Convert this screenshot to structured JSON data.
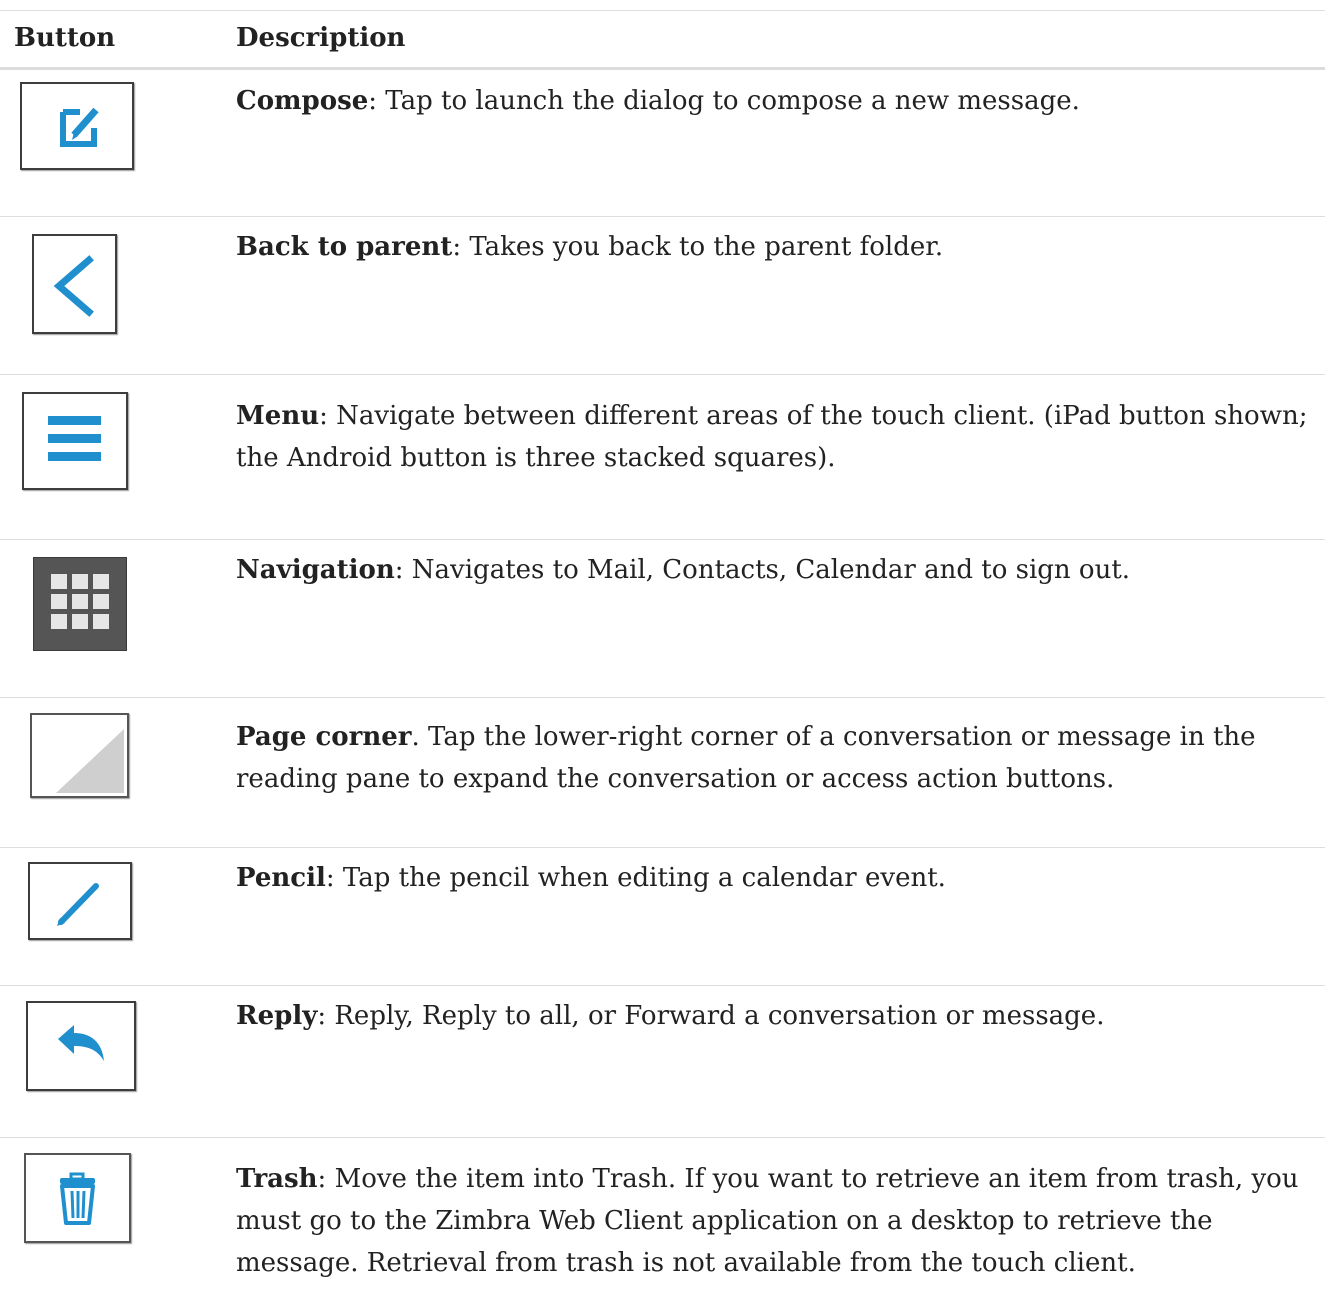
{
  "header": {
    "button_col": "Button",
    "description_col": "Description"
  },
  "rows": [
    {
      "icon": "compose-icon",
      "term": "Compose",
      "sep": ": ",
      "text": "Tap to launch the dialog to compose a new message."
    },
    {
      "icon": "back-arrow-icon",
      "term": "Back to parent",
      "sep": ": ",
      "text": "Takes you back to the parent folder."
    },
    {
      "icon": "menu-icon",
      "term": "Menu",
      "sep": ": ",
      "text": "Navigate between different areas of the touch client. (iPad button shown; the Android button is three stacked squares)."
    },
    {
      "icon": "grid-icon",
      "term": "Navigation",
      "sep": ": ",
      "text": "Navigates to Mail, Contacts, Calendar and to sign out."
    },
    {
      "icon": "page-corner-icon",
      "term": "Page corner",
      "sep": ". ",
      "text": "Tap the lower-right corner of a conversation or message in the reading pane to expand the conversation or access action buttons."
    },
    {
      "icon": "pencil-icon",
      "term": "Pencil",
      "sep": ": ",
      "text": "Tap the pencil when editing a calendar event."
    },
    {
      "icon": "reply-icon",
      "term": "Reply",
      "sep": ": ",
      "text": "Reply, Reply to all, or Forward a conversation or message."
    },
    {
      "icon": "trash-icon",
      "term": "Trash",
      "sep": ": ",
      "text": "Move the item into Trash. If you want to retrieve an item from trash, you must go to the Zimbra Web Client application on a desktop to retrieve the message. Retrieval from trash is not available from the touch client."
    }
  ],
  "colors": {
    "icon_blue": "#1f8fce",
    "grid_bg": "#555555",
    "divider": "#dedede"
  }
}
